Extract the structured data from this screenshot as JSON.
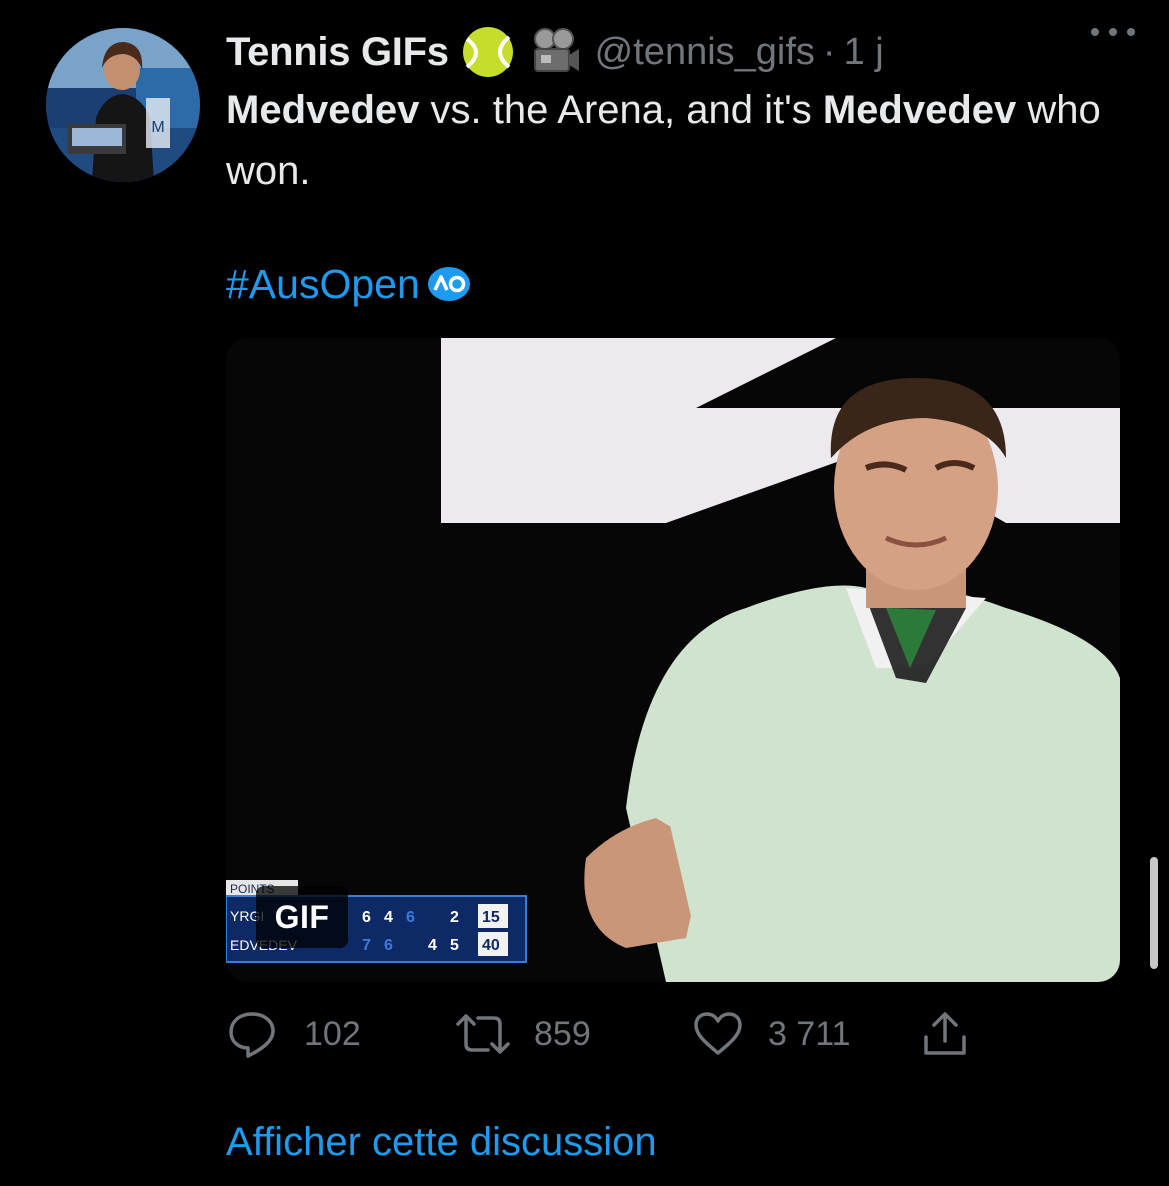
{
  "author": {
    "display_name": "Tennis GIFs",
    "handle": "@tennis_gifs",
    "separator": "·",
    "time": "1 j",
    "badges": [
      "tennis-ball-emoji",
      "movie-camera-emoji"
    ]
  },
  "tweet": {
    "text_part1": "Medvedev",
    "text_part2": " vs. the Arena, and it's ",
    "text_part3": "Medvedev",
    "text_part4": " who won.",
    "hashtag": "#AusOpen"
  },
  "media": {
    "badge": "GIF",
    "scoreboard": {
      "header": "POINTS",
      "player1": "YRGI",
      "player2": "EDVEDEV",
      "player1_sets": [
        "6",
        "4",
        "6",
        "2"
      ],
      "player2_sets": [
        "7",
        "6",
        "4",
        "5"
      ],
      "player1_points": "15",
      "player2_points": "40"
    }
  },
  "actions": {
    "replies": "102",
    "retweets": "859",
    "likes": "3 711"
  },
  "show_thread": "Afficher cette discussion",
  "colors": {
    "background": "#000000",
    "text": "#e7e9ea",
    "secondary": "#71767b",
    "accent": "#1d9bf0"
  }
}
